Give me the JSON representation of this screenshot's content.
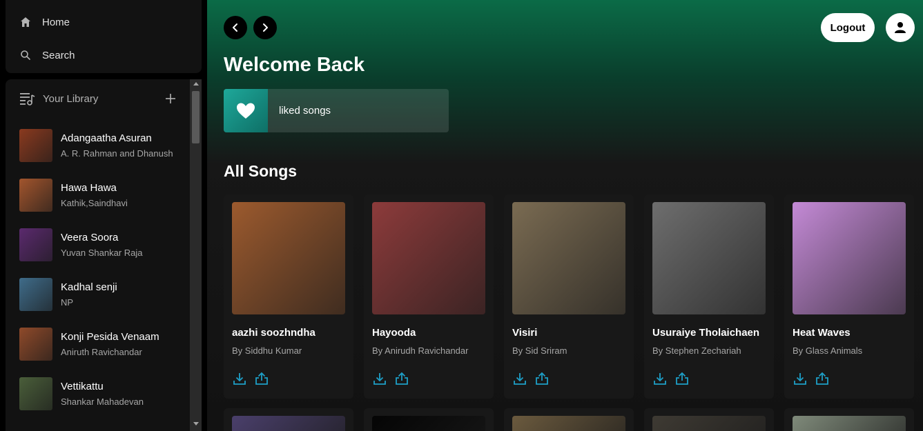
{
  "nav": {
    "home_label": "Home",
    "search_label": "Search"
  },
  "library": {
    "title": "Your Library",
    "items": [
      {
        "title": "Adangaatha Asuran",
        "artist": "A. R. Rahman and Dhanush",
        "color": "#8a3a1f"
      },
      {
        "title": "Hawa Hawa",
        "artist": "Kathik,Saindhavi",
        "color": "#a2552d"
      },
      {
        "title": "Veera Soora",
        "artist": "Yuvan Shankar Raja",
        "color": "#5b2a6e"
      },
      {
        "title": "Kadhal senji",
        "artist": "NP",
        "color": "#3f6c8a"
      },
      {
        "title": "Konji Pesida Venaam",
        "artist": "Aniruth Ravichandar",
        "color": "#8f4a2a"
      },
      {
        "title": "Vettikattu",
        "artist": "Shankar Mahadevan",
        "color": "#4a5e3a"
      }
    ]
  },
  "header": {
    "logout_label": "Logout"
  },
  "main": {
    "welcome": "Welcome Back",
    "liked_label": "liked songs",
    "section_title": "All Songs",
    "songs": [
      {
        "title": "aazhi soozhndha",
        "artist": "By Siddhu Kumar",
        "color": "#9c5a2e"
      },
      {
        "title": "Hayooda",
        "artist": "By Anirudh Ravichandar",
        "color": "#8d3b3b"
      },
      {
        "title": "Visiri",
        "artist": "By Sid Sriram",
        "color": "#7a6b52"
      },
      {
        "title": "Usuraiye Tholaichaen",
        "artist": "By Stephen Zechariah",
        "color": "#6e6e6e"
      },
      {
        "title": "Heat Waves",
        "artist": "By Glass Animals",
        "color": "#c48ad6"
      }
    ],
    "next_row_colors": [
      "#4a3f6b",
      "#050505",
      "#6b5a3e",
      "#3e3a33",
      "#7f8a7a"
    ]
  },
  "colors": {
    "accent": "#1ea0c8",
    "brand_green": "#0b6b47"
  }
}
